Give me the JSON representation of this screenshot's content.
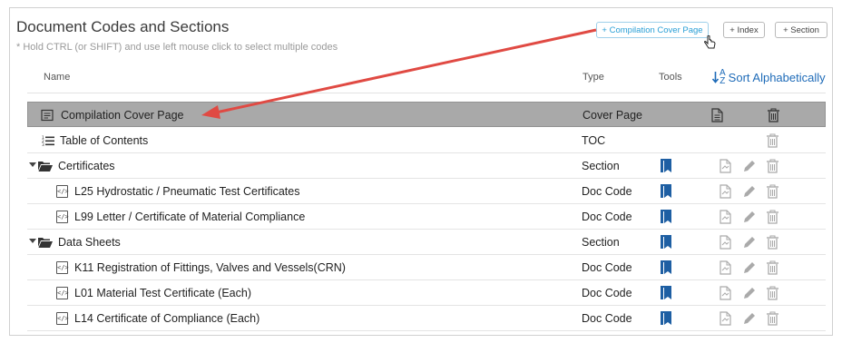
{
  "panel": {
    "title": "Document Codes and Sections",
    "hint": "* Hold CTRL (or SHIFT) and use left mouse click to select multiple codes"
  },
  "header_buttons": {
    "compilation_cover": "+ Compilation Cover Page",
    "index": "+ Index",
    "section": "+ Section"
  },
  "columns": {
    "name": "Name",
    "type": "Type",
    "tools": "Tools",
    "sort": "Sort Alphabetically"
  },
  "rows": [
    {
      "name": "Compilation Cover Page",
      "type": "Cover Page",
      "kind": "cover",
      "highlighted": true
    },
    {
      "name": "Table of Contents",
      "type": "TOC",
      "kind": "toc"
    },
    {
      "name": "Certificates",
      "type": "Section",
      "kind": "section"
    },
    {
      "name": "L25 Hydrostatic / Pneumatic Test Certificates",
      "type": "Doc Code",
      "kind": "code"
    },
    {
      "name": "L99 Letter / Certificate of Material Compliance",
      "type": "Doc Code",
      "kind": "code"
    },
    {
      "name": "Data Sheets",
      "type": "Section",
      "kind": "section"
    },
    {
      "name": "K11 Registration of Fittings, Valves and Vessels(CRN)",
      "type": "Doc Code",
      "kind": "code"
    },
    {
      "name": "L01 Material Test Certificate (Each)",
      "type": "Doc Code",
      "kind": "code"
    },
    {
      "name": "L14 Certificate of Compliance (Each)",
      "type": "Doc Code",
      "kind": "code"
    }
  ],
  "colors": {
    "accent_blue": "#1e6bb8",
    "highlight_row": "#a9a9a9",
    "annotation_arrow": "#e04a43"
  }
}
